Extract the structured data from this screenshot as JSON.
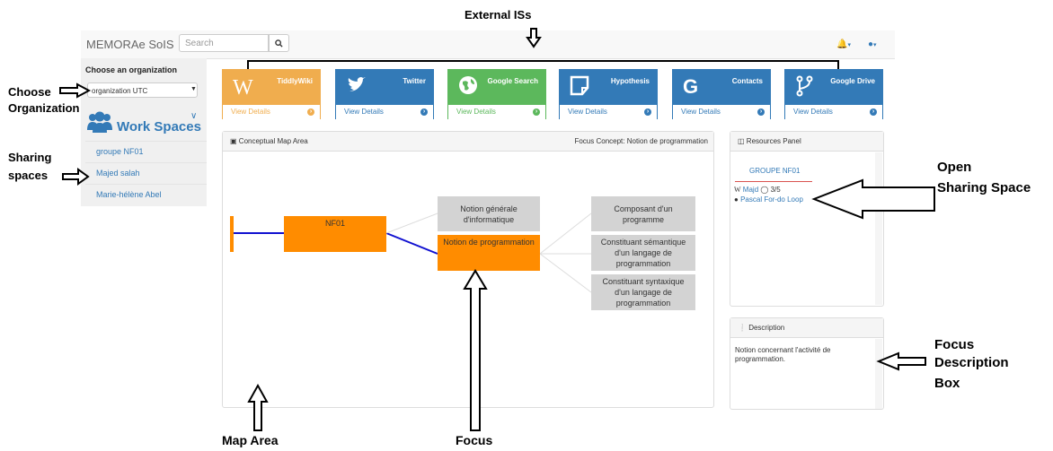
{
  "navbar": {
    "brand": "MEMORAe SoIS",
    "search_placeholder": "Search"
  },
  "sidebar": {
    "choose_label": "Choose an organization",
    "org_value": "organization UTC",
    "workspaces_title": "Work Spaces",
    "spaces": [
      "groupe NF01",
      "Majed salah",
      "Marie-hélène Abel"
    ]
  },
  "cards": [
    {
      "title": "TiddlyWiki",
      "link": "View Details",
      "color": "#f0ad4e"
    },
    {
      "title": "Twitter",
      "link": "View Details",
      "color": "#337ab7"
    },
    {
      "title": "Google Search",
      "link": "View Details",
      "color": "#5cb85c"
    },
    {
      "title": "Hypothesis",
      "link": "View Details",
      "color": "#337ab7"
    },
    {
      "title": "Contacts",
      "link": "View Details",
      "color": "#337ab7"
    },
    {
      "title": "Google Drive",
      "link": "View Details",
      "color": "#337ab7"
    }
  ],
  "map": {
    "title": "Conceptual Map Area",
    "focus_label": "Focus Concept: Notion de programmation",
    "nodes": {
      "root": "NF01",
      "general": "Notion générale d'informatique",
      "focus": "Notion de programmation",
      "composant": "Composant d'un programme",
      "semantique": "Constituant sémantique d'un langage de programmation",
      "syntaxique": "Constituant syntaxique d'un langage de programmation"
    }
  },
  "resources": {
    "title": "Resources Panel",
    "group": "GROUPE NF01",
    "item1_name": "Majd",
    "item1_count": "3/5",
    "item2_name": "Pascal For-do Loop"
  },
  "description": {
    "title": "Description",
    "text": "Notion concernant l'activité de programmation."
  },
  "annotations": {
    "external": "External ISs",
    "choose1": "Choose",
    "choose2": "Organization",
    "sharing1": "Sharing",
    "sharing2": "spaces",
    "open1": "Open",
    "open2": "Sharing Space",
    "focusdesc1": "Focus",
    "focusdesc2": "Description",
    "focusdesc3": "Box",
    "maparea": "Map Area",
    "focus": "Focus"
  }
}
